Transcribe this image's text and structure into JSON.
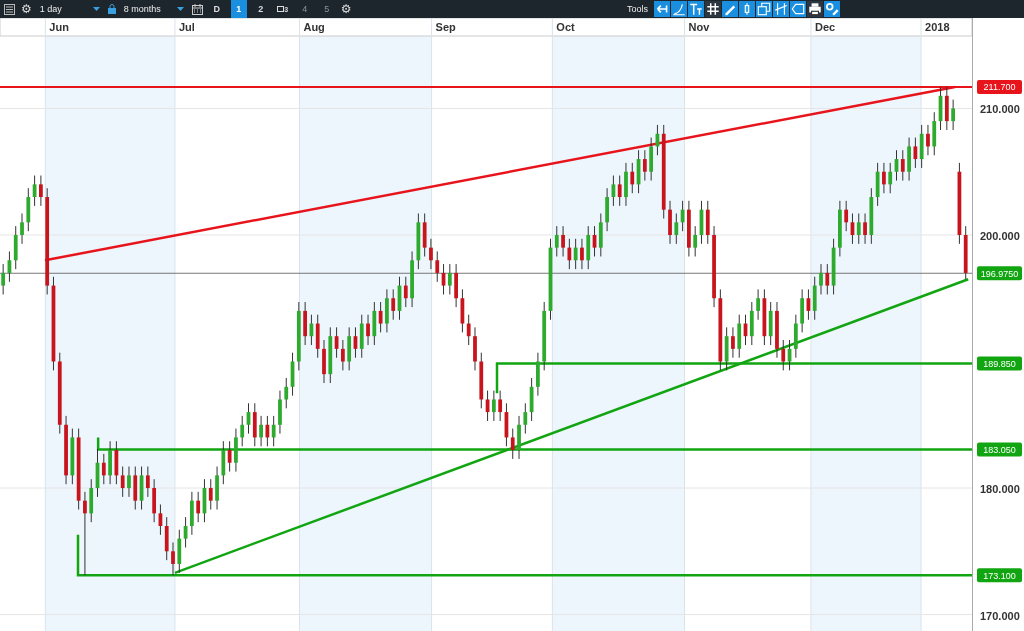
{
  "toolbar": {
    "settings_glyph": "⚙",
    "interval": "1 day",
    "range": "8 months",
    "period_buttons": [
      {
        "label": "D",
        "kind": "text",
        "selected": false,
        "disabled": false
      },
      {
        "label": "1",
        "kind": "text",
        "selected": true,
        "disabled": false
      },
      {
        "label": "2",
        "kind": "text",
        "selected": false,
        "disabled": false
      },
      {
        "label": "3",
        "kind": "icon",
        "selected": false,
        "disabled": false
      },
      {
        "label": "4",
        "kind": "text",
        "selected": false,
        "disabled": true
      },
      {
        "label": "5",
        "kind": "text",
        "selected": false,
        "disabled": true
      }
    ],
    "chart_settings_glyph": "⚙",
    "tools_label": "Tools"
  },
  "chart": {
    "price_tags": [
      {
        "label": "211.700",
        "color": "#e8141c"
      },
      {
        "label": "196.9750",
        "color": "#12a512"
      },
      {
        "label": "189.850",
        "color": "#12a512"
      },
      {
        "label": "183.050",
        "color": "#12a512"
      },
      {
        "label": "173.100",
        "color": "#12a512"
      }
    ],
    "months": [
      "Jun",
      "Jul",
      "Aug",
      "Sep",
      "Oct",
      "Nov",
      "Dec",
      "2018"
    ],
    "chart_data": {
      "type": "candlestick",
      "ylim": [
        168.7,
        217.15
      ],
      "grid": true,
      "categories": [
        null,
        null,
        null,
        null,
        null,
        null,
        null,
        null,
        null,
        null,
        null,
        null,
        null,
        null,
        null,
        null,
        null,
        null,
        null,
        null,
        null,
        null,
        null,
        null,
        null,
        null,
        null,
        null,
        null,
        null,
        null,
        null,
        null,
        null,
        null,
        null,
        null,
        null,
        null,
        null,
        null,
        null,
        null,
        null,
        null,
        null,
        null,
        null,
        null,
        null,
        null,
        null,
        null,
        null,
        null,
        null,
        null,
        null,
        null,
        null,
        null,
        null,
        null,
        null,
        null,
        null,
        null,
        null,
        null,
        null,
        null,
        null,
        null,
        null,
        null,
        null,
        null,
        null,
        null,
        null,
        null,
        null,
        null,
        null,
        null,
        null,
        null,
        null,
        null,
        null,
        null,
        null,
        null,
        null,
        null,
        null,
        null,
        null,
        null,
        null,
        null,
        null,
        null,
        null,
        null,
        null,
        null,
        null,
        null,
        null,
        null,
        null,
        null,
        null,
        null,
        null,
        null,
        null,
        null,
        null,
        null,
        null,
        null,
        null,
        null,
        null,
        null,
        null,
        null,
        null,
        null,
        null,
        null,
        null,
        null,
        null,
        null,
        null,
        null,
        null,
        null,
        null,
        null,
        null,
        null,
        null,
        null,
        null,
        null,
        null,
        null,
        null,
        null,
        null
      ],
      "yticks": [
        {
          "value": 170,
          "label": "170.000"
        },
        {
          "value": 180,
          "label": "180.000"
        },
        {
          "value": 200,
          "label": "200.000"
        },
        {
          "value": 210,
          "label": "210.000"
        }
      ],
      "ohlc": [
        [
          196,
          197.7,
          195.3,
          197
        ],
        [
          197,
          198.7,
          196.3,
          198
        ],
        [
          198,
          200.7,
          197.3,
          200
        ],
        [
          200,
          201.7,
          199.3,
          201
        ],
        [
          201,
          203.7,
          200.3,
          203
        ],
        [
          203,
          204.7,
          202.3,
          204
        ],
        [
          204,
          204.7,
          202.3,
          203
        ],
        [
          203,
          203.7,
          195.3,
          196
        ],
        [
          196,
          196.7,
          189.3,
          190
        ],
        [
          190,
          190.7,
          184.3,
          185
        ],
        [
          185,
          185.7,
          180.3,
          181
        ],
        [
          181,
          184.7,
          180.3,
          184
        ],
        [
          184,
          184.7,
          178.3,
          179
        ],
        [
          179,
          179.7,
          173.1,
          178
        ],
        [
          178,
          180.7,
          177.3,
          180
        ],
        [
          180,
          183.1,
          179.3,
          182
        ],
        [
          182,
          182.7,
          180.3,
          181
        ],
        [
          181,
          183.7,
          180.3,
          183
        ],
        [
          183,
          183.7,
          180.3,
          181
        ],
        [
          181,
          181.7,
          179.3,
          180
        ],
        [
          180,
          181.7,
          179.3,
          181
        ],
        [
          181,
          181.7,
          178.3,
          179
        ],
        [
          179,
          181.7,
          178.3,
          181
        ],
        [
          181,
          181.7,
          179.3,
          180
        ],
        [
          180,
          180.7,
          177.3,
          178
        ],
        [
          178,
          178.7,
          176.3,
          177
        ],
        [
          177,
          177.7,
          174.3,
          175
        ],
        [
          175,
          175.7,
          173.1,
          174
        ],
        [
          174,
          176.7,
          173.3,
          176
        ],
        [
          176,
          177.7,
          175.3,
          177
        ],
        [
          177,
          179.7,
          176.3,
          179
        ],
        [
          179,
          179.7,
          177.3,
          178
        ],
        [
          178,
          180.7,
          177.3,
          180
        ],
        [
          180,
          180.7,
          178.3,
          179
        ],
        [
          179,
          181.7,
          178.3,
          181
        ],
        [
          181,
          183.7,
          180.3,
          183
        ],
        [
          183,
          183.7,
          181.3,
          182
        ],
        [
          182,
          184.7,
          181.3,
          184
        ],
        [
          184,
          185.7,
          183.3,
          185
        ],
        [
          185,
          186.7,
          184.3,
          186
        ],
        [
          186,
          186.7,
          183.3,
          184
        ],
        [
          184,
          185.7,
          183.3,
          185
        ],
        [
          185,
          185.7,
          183.3,
          184
        ],
        [
          184,
          185.7,
          183.3,
          185
        ],
        [
          185,
          187.7,
          184.3,
          187
        ],
        [
          187,
          188.7,
          186.3,
          188
        ],
        [
          188,
          190.7,
          187.3,
          190
        ],
        [
          190,
          194.7,
          189.3,
          194
        ],
        [
          194,
          194.7,
          191.3,
          192
        ],
        [
          192,
          193.7,
          191.3,
          193
        ],
        [
          193,
          193.7,
          190.3,
          191
        ],
        [
          191,
          191.7,
          188.3,
          189
        ],
        [
          189,
          192.7,
          188.3,
          192
        ],
        [
          192,
          192.7,
          190.3,
          191
        ],
        [
          191,
          191.7,
          189.3,
          190
        ],
        [
          190,
          192.7,
          189.3,
          192
        ],
        [
          192,
          192.7,
          190.3,
          191
        ],
        [
          191,
          193.7,
          190.3,
          193
        ],
        [
          193,
          193.7,
          191.3,
          192
        ],
        [
          192,
          194.7,
          191.3,
          194
        ],
        [
          194,
          194.7,
          192.3,
          193
        ],
        [
          193,
          195.7,
          192.3,
          195
        ],
        [
          195,
          195.7,
          193.3,
          194
        ],
        [
          194,
          196.7,
          193.3,
          196
        ],
        [
          196,
          196.7,
          194.3,
          195
        ],
        [
          195,
          198.7,
          194.3,
          198
        ],
        [
          198,
          201.7,
          197.3,
          201
        ],
        [
          201,
          201.7,
          198.3,
          199
        ],
        [
          199,
          199.7,
          197.3,
          198
        ],
        [
          198,
          198.7,
          196.3,
          197
        ],
        [
          197,
          197.7,
          195.3,
          196
        ],
        [
          196,
          197.7,
          195.3,
          197
        ],
        [
          197,
          197.7,
          194.3,
          195
        ],
        [
          195,
          195.7,
          192.3,
          193
        ],
        [
          193,
          193.7,
          191.3,
          192
        ],
        [
          192,
          192.7,
          189.3,
          190
        ],
        [
          190,
          190.7,
          186.3,
          187
        ],
        [
          187,
          187.7,
          185.3,
          186
        ],
        [
          186,
          187.7,
          185.3,
          187
        ],
        [
          187,
          187.7,
          185.3,
          186
        ],
        [
          186,
          186.7,
          183.3,
          184
        ],
        [
          184,
          184.7,
          182.3,
          183
        ],
        [
          183,
          185.7,
          182.3,
          185
        ],
        [
          185,
          186.7,
          184.3,
          186
        ],
        [
          186,
          188.7,
          185.3,
          188
        ],
        [
          188,
          190.7,
          187.3,
          190
        ],
        [
          190,
          194.7,
          189.3,
          194
        ],
        [
          194,
          199.7,
          193.3,
          199
        ],
        [
          199,
          200.7,
          198.3,
          200
        ],
        [
          200,
          200.7,
          198.3,
          199
        ],
        [
          199,
          199.7,
          197.3,
          198
        ],
        [
          198,
          199.7,
          197.3,
          199
        ],
        [
          199,
          199.7,
          197.3,
          198
        ],
        [
          198,
          200.7,
          197.3,
          200
        ],
        [
          200,
          200.7,
          198.3,
          199
        ],
        [
          199,
          201.7,
          198.3,
          201
        ],
        [
          201,
          203.7,
          200.3,
          203
        ],
        [
          203,
          204.7,
          202.3,
          204
        ],
        [
          204,
          204.7,
          202.3,
          203
        ],
        [
          203,
          205.7,
          202.3,
          205
        ],
        [
          205,
          205.7,
          203.3,
          204
        ],
        [
          204,
          206.7,
          203.3,
          206
        ],
        [
          206,
          206.7,
          204.3,
          205
        ],
        [
          205,
          207.7,
          204.3,
          207
        ],
        [
          207,
          208.7,
          206.3,
          208
        ],
        [
          208,
          208.7,
          201.3,
          202
        ],
        [
          202,
          202.7,
          199.3,
          200
        ],
        [
          200,
          201.7,
          199.3,
          201
        ],
        [
          201,
          202.7,
          200.3,
          202
        ],
        [
          202,
          202.7,
          198.3,
          199
        ],
        [
          199,
          200.7,
          198.3,
          200
        ],
        [
          200,
          202.7,
          199.3,
          202
        ],
        [
          202,
          202.7,
          199.3,
          200
        ],
        [
          200,
          200.7,
          194.3,
          195
        ],
        [
          195,
          195.7,
          189.3,
          190
        ],
        [
          190,
          192.7,
          189.3,
          192
        ],
        [
          192,
          192.7,
          190.3,
          191
        ],
        [
          191,
          193.7,
          190.3,
          193
        ],
        [
          193,
          193.7,
          191.3,
          192
        ],
        [
          192,
          194.7,
          191.3,
          194
        ],
        [
          194,
          195.7,
          193.3,
          195
        ],
        [
          195,
          195.7,
          191.3,
          192
        ],
        [
          192,
          194.7,
          191.3,
          194
        ],
        [
          194,
          194.7,
          190.3,
          191
        ],
        [
          191,
          191.7,
          189.3,
          190
        ],
        [
          190,
          191.7,
          189.3,
          191
        ],
        [
          191,
          193.7,
          190.3,
          193
        ],
        [
          193,
          195.7,
          192.3,
          195
        ],
        [
          195,
          195.7,
          193.3,
          194
        ],
        [
          194,
          196.7,
          193.3,
          196
        ],
        [
          196,
          197.7,
          195.3,
          197
        ],
        [
          197,
          197.7,
          195.3,
          196
        ],
        [
          196,
          199.7,
          195.3,
          199
        ],
        [
          199,
          202.7,
          198.3,
          202
        ],
        [
          202,
          202.7,
          200.3,
          201
        ],
        [
          201,
          201.7,
          199.3,
          200
        ],
        [
          200,
          201.7,
          199.3,
          201
        ],
        [
          201,
          201.7,
          199.3,
          200
        ],
        [
          200,
          203.7,
          199.3,
          203
        ],
        [
          203,
          205.7,
          202.3,
          205
        ],
        [
          205,
          205.7,
          203.3,
          204
        ],
        [
          204,
          205.7,
          203.3,
          205
        ],
        [
          205,
          206.7,
          204.3,
          206
        ],
        [
          206,
          206.7,
          204.3,
          205
        ],
        [
          205,
          207.7,
          204.3,
          207
        ],
        [
          207,
          207.7,
          205.3,
          206
        ],
        [
          206,
          208.7,
          205.3,
          208
        ],
        [
          208,
          208.7,
          206.3,
          207
        ],
        [
          207,
          209.7,
          206.3,
          209
        ],
        [
          209,
          211.7,
          208.3,
          211
        ],
        [
          211,
          211.7,
          208.3,
          209
        ],
        [
          209,
          210.7,
          208.3,
          210
        ],
        [
          205,
          205.7,
          199.3,
          200
        ],
        [
          200,
          200.7,
          196.5,
          197
        ]
      ]
    }
  }
}
